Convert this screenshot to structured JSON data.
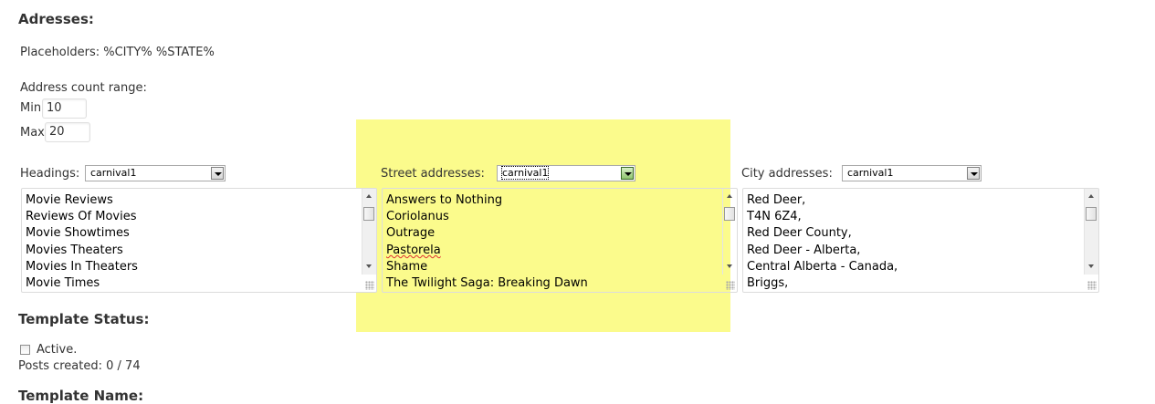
{
  "addresses": {
    "heading": "Adresses:",
    "placeholders_text": "Placeholders: %CITY% %STATE%",
    "count_range_label": "Address count range:",
    "min_label": "Min",
    "min_value": "10",
    "max_label": "Max",
    "max_value": "20"
  },
  "headings": {
    "label": "Headings:",
    "selected": "carnival1",
    "items": [
      "Movie Reviews",
      "Reviews Of Movies",
      "Movie Showtimes",
      "Movies Theaters",
      "Movies In Theaters",
      "Movie Times"
    ]
  },
  "street": {
    "label": "Street addresses:",
    "selected": "carnival1",
    "items": [
      "Answers to Nothing",
      "Coriolanus",
      "Outrage",
      "Pastorela",
      "Shame",
      "The Twilight Saga: Breaking Dawn"
    ]
  },
  "city": {
    "label": "City addresses:",
    "selected": "carnival1",
    "items": [
      "Red Deer,",
      "T4N 6Z4,",
      "Red Deer County,",
      "Red Deer - Alberta,",
      "Central Alberta - Canada,",
      "Briggs,"
    ]
  },
  "template_status": {
    "heading": "Template Status:",
    "active_label": "Active.",
    "active_checked": false,
    "posts_created": "Posts created: 0 / 74"
  },
  "template_name": {
    "heading": "Template Name:"
  },
  "colors": {
    "highlight": "#fbfb86"
  }
}
